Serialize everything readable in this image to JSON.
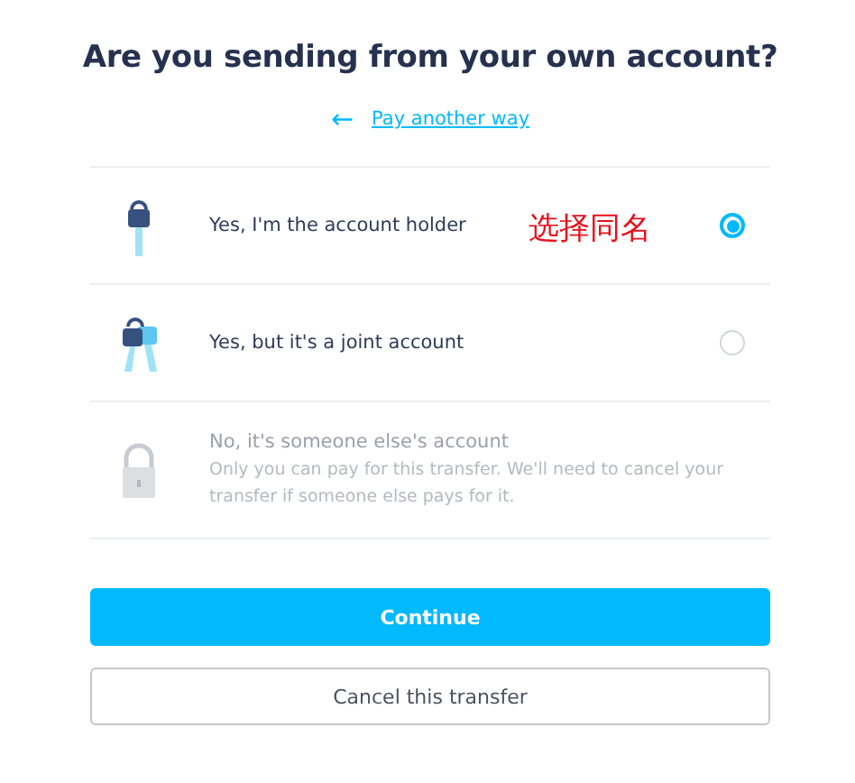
{
  "title": "Are you sending from your own account?",
  "back_link": {
    "arrow": "←",
    "label": "Pay another way"
  },
  "options": [
    {
      "kind": "key",
      "label": "Yes, I'm the account holder",
      "selected": true,
      "disabled": false
    },
    {
      "kind": "keys",
      "label": "Yes, but it's a joint account",
      "selected": false,
      "disabled": false
    },
    {
      "kind": "lock",
      "label": "No, it's someone else's account",
      "description": "Only you can pay for this transfer. We'll need to cancel your transfer if someone else pays for it.",
      "disabled": true
    }
  ],
  "annotation": "选择同名",
  "buttons": [
    {
      "kind": "primary",
      "label": "Continue"
    },
    {
      "kind": "secondary",
      "label": "Cancel this transfer"
    }
  ]
}
